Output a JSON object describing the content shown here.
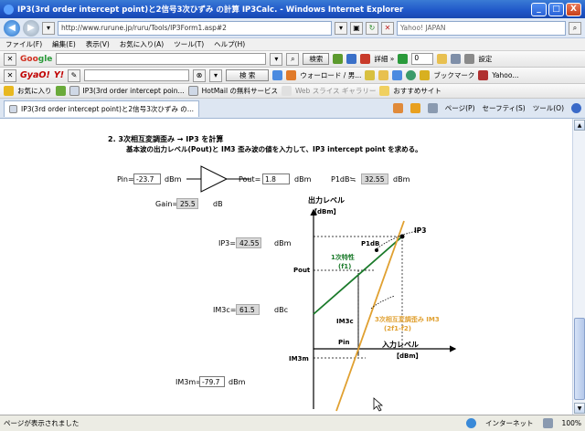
{
  "window": {
    "title": "IP3(3rd order intercept point)と2信号3次ひずみ の計算 IP3Calc. - Windows Internet Explorer",
    "minimize": "_",
    "maximize": "□",
    "close": "X"
  },
  "address_bar": {
    "url": "http://www.rurune.jp/ruru/Tools/IP3Form1.asp#2",
    "search_text": "Yahoo! JAPAN"
  },
  "menu": [
    "ファイル(F)",
    "編集(E)",
    "表示(V)",
    "お気に入り(A)",
    "ツール(T)",
    "ヘルプ(H)"
  ],
  "google_bar": {
    "logo_a": "Goo",
    "logo_b": "gle",
    "search_label": "検索",
    "extra_label": "詳細 »",
    "counter": "0",
    "settings_label": "設定"
  },
  "gyao_bar": {
    "logo": "GyaO!",
    "yahoo_logo": "Y!",
    "search_label": "検 索",
    "items": [
      "ウォーロード / 男...",
      "ブックマーク",
      "Yahoo..."
    ]
  },
  "favorites_bar": {
    "label": "お気に入り",
    "items": [
      "IP3(3rd order intercept poin...",
      "HotMail の無料サービス",
      "Web スライス ギャラリー",
      "おすすめサイト"
    ]
  },
  "tab": {
    "label": "IP3(3rd order intercept point)と2信号3次ひずみ の...",
    "tools": [
      "ページ(P)",
      "セーフティ(S)",
      "ツール(O)"
    ]
  },
  "content": {
    "heading": "2. 3次相互変調歪み → IP3 を計算",
    "subheading": "基本波の出力レベル(Pout)と IM3 歪み波の値を入力して、IP3 intercept point を求める。",
    "pin_label": "Pin=",
    "pin_value": "-23.7",
    "pin_unit": "dBm",
    "pout_label": "Pout=",
    "pout_value": "1.8",
    "pout_unit": "dBm",
    "p1db_label": "P1dB≒",
    "p1db_value": "32.55",
    "p1db_unit": "dBm",
    "gain_label": "Gain=",
    "gain_value": "25.5",
    "gain_unit": "dB",
    "ip3_label": "IP3=",
    "ip3_value": "42.55",
    "ip3_unit": "dBm",
    "im3c_label": "IM3c=",
    "im3c_value": "61.5",
    "im3c_unit": "dBc",
    "im3m_label": "IM3m=",
    "im3m_value": "-79.7",
    "im3m_unit": "dBm"
  },
  "diagram": {
    "y_axis_label": "出力レベル",
    "y_axis_unit": "【dBm】",
    "x_axis_label": "入力レベル",
    "x_axis_unit": "【dBm】",
    "ip3": "IP3",
    "p1db": "P1dB",
    "primary_a": "1次特性",
    "primary_b": "(f1)",
    "pout": "Pout",
    "im3c": "IM3c",
    "pin": "Pin",
    "im3m": "IM3m",
    "third_a": "3次相互変調歪み  IM3",
    "third_b": "(2f1-f2)",
    "colors": {
      "primary": "#1a7a2a",
      "third": "#e0a030",
      "axis": "#000000"
    }
  },
  "status": {
    "text": "ページが表示されました",
    "zone": "インターネット",
    "zoom": "100%"
  }
}
